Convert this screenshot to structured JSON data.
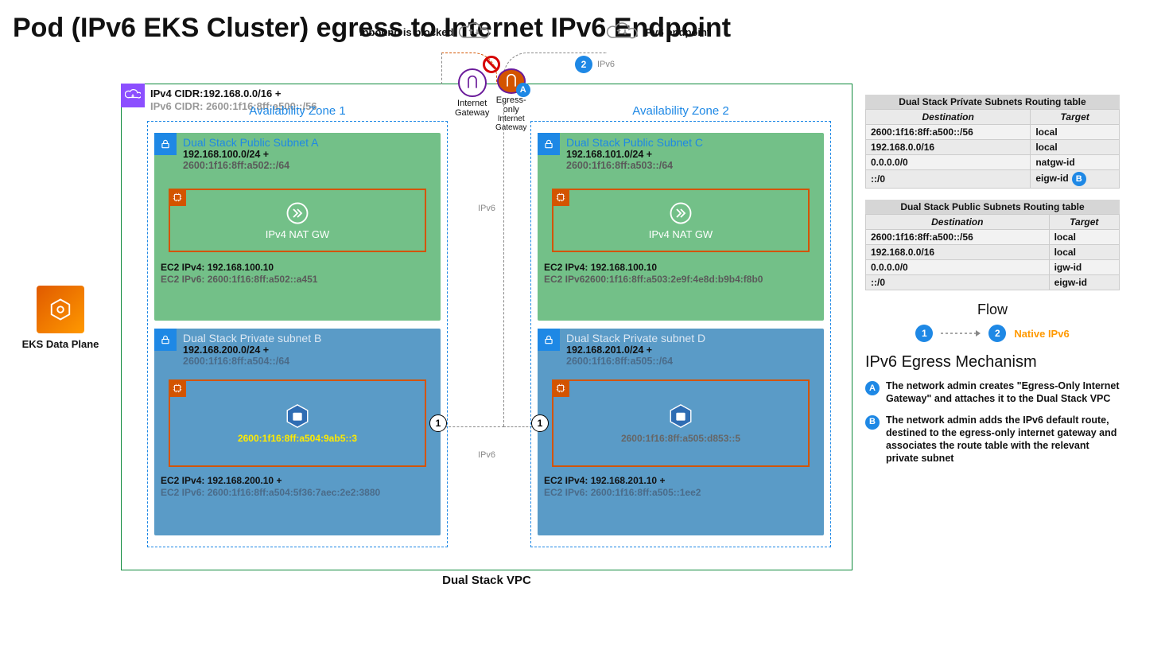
{
  "title": "Pod (IPv6 EKS Cluster) egress to Internet IPv6 Endpoint",
  "eks_label": "EKS Data Plane",
  "top_left_annot": "Inbound is blocked",
  "top_right_annot": "IPv6 endpoint",
  "top_flow_label": "IPv6",
  "igw_label": "Internet Gateway",
  "eigw_label": "Egress-only",
  "eigw_sub": "Internet Gateway",
  "eigw_letter": "A",
  "spine_ipv6": "IPv6",
  "vpc_caption": "Dual Stack VPC",
  "vpc_ipv4": "IPv4 CIDR:192.168.0.0/16 +",
  "vpc_ipv6": "IPv6 CIDR: 2600:1f16:8ff:a500::/56",
  "az1_label": "Availability Zone 1",
  "az2_label": "Availability Zone 2",
  "subA": {
    "title": "Dual Stack Public Subnet A",
    "v4": "192.168.100.0/24 +",
    "v6": "2600:1f16:8ff:a502::/64",
    "nat": "IPv4 NAT GW",
    "ec2v4": "EC2 IPv4: 192.168.100.10",
    "ec2v6": "EC2 IPv6: 2600:1f16:8ff:a502::a451"
  },
  "subC": {
    "title": "Dual Stack Public Subnet C",
    "v4": "192.168.101.0/24 +",
    "v6": "2600:1f16:8ff:a503::/64",
    "nat": "IPv4 NAT GW",
    "ec2v4": "EC2 IPv4: 192.168.100.10",
    "ec2v6": "EC2 IPv62600:1f16:8ff:a503:2e9f:4e8d:b9b4:f8b0"
  },
  "subB": {
    "title": "Dual Stack Private subnet B",
    "v4": "192.168.200.0/24 +",
    "v6": "2600:1f16:8ff:a504::/64",
    "pod_ip": "2600:1f16:8ff:a504:9ab5::3",
    "ec2v4": "EC2 IPv4: 192.168.200.10 +",
    "ec2v6": "EC2 IPv6: 2600:1f16:8ff:a504:5f36:7aec:2e2:3880"
  },
  "subD": {
    "title": "Dual Stack Private subnet D",
    "v4": "192.168.201.0/24 +",
    "v6": "2600:1f16:8ff:a505::/64",
    "pod_ip": "2600:1f16:8ff:a505:d853::5",
    "ec2v4": "EC2 IPv4: 192.168.201.10 +",
    "ec2v6": "EC2 IPv6: 2600:1f16:8ff:a505::1ee2"
  },
  "step_one": "1",
  "step_two": "2",
  "routing": {
    "private": {
      "caption": "Dual Stack Prívate Subnets Routing table",
      "h1": "Destination",
      "h2": "Target",
      "rows": [
        {
          "d": "2600:1f16:8ff:a500::/56",
          "t": "local"
        },
        {
          "d": "192.168.0.0/16",
          "t": "local"
        },
        {
          "d": "0.0.0.0/0",
          "t": "natgw-id"
        },
        {
          "d": "::/0",
          "t": "eigw-id",
          "badge": "B"
        }
      ]
    },
    "public": {
      "caption": "Dual Stack Public Subnets Routing table",
      "h1": "Destination",
      "h2": "Target",
      "rows": [
        {
          "d": "2600:1f16:8ff:a500::/56",
          "t": "local"
        },
        {
          "d": "192.168.0.0/16",
          "t": "local"
        },
        {
          "d": "0.0.0.0/0",
          "t": "igw-id"
        },
        {
          "d": "::/0",
          "t": "eigw-id"
        }
      ]
    }
  },
  "flow_heading": "Flow",
  "flow_native": "Native IPv6",
  "mech_heading": "IPv6 Egress Mechanism",
  "mech": {
    "A": "The network admin creates \"Egress-Only Internet Gateway\" and attaches it to the Dual Stack VPC",
    "B": "The network admin adds the IPv6 default route, destined to the egress-only internet gateway and associates the route table with the relevant private subnet"
  }
}
